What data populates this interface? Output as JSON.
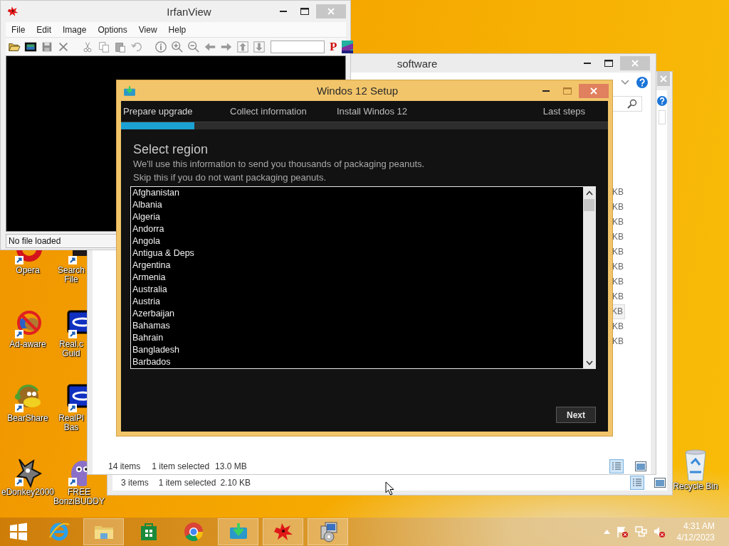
{
  "irfanview": {
    "title": "IrfanView",
    "menu": [
      "File",
      "Edit",
      "Image",
      "Options",
      "View",
      "Help"
    ],
    "toolbar_letter": "P",
    "status": "No file loaded"
  },
  "desktop_icons": [
    {
      "kind": "opera",
      "label": "Opera"
    },
    {
      "kind": "adaware",
      "label": "Ad-aware"
    },
    {
      "kind": "bear",
      "label": "BearShare"
    },
    {
      "kind": "donkey",
      "label": "eDonkey2000"
    },
    {
      "kind": "search",
      "label": "Search File"
    },
    {
      "kind": "real",
      "label": "Real.c Guid"
    },
    {
      "kind": "real",
      "label": "RealPl Bas"
    },
    {
      "kind": "bonzi",
      "label": "FREE BonziBUDDY"
    }
  ],
  "recycle_bin": {
    "label": "Recycle Bin"
  },
  "explorer_back": {
    "status_items": "3 items",
    "status_selection": "1 item selected",
    "status_size": "2.10 KB"
  },
  "explorer_front": {
    "title": "software",
    "size_cells": [
      {
        "text": "KB",
        "selected": false
      },
      {
        "text": "KB",
        "selected": false
      },
      {
        "text": "KB",
        "selected": false
      },
      {
        "text": "KB",
        "selected": false
      },
      {
        "text": "KB",
        "selected": false
      },
      {
        "text": "KB",
        "selected": false
      },
      {
        "text": "KB",
        "selected": false
      },
      {
        "text": "KB",
        "selected": false
      },
      {
        "text": "KB",
        "selected": true
      },
      {
        "text": "KB",
        "selected": false
      },
      {
        "text": "KB",
        "selected": false
      }
    ],
    "status_items": "14 items",
    "status_selection": "1 item selected",
    "status_size": "13.0 MB"
  },
  "setup": {
    "title": "Windos 12 Setup",
    "steps": [
      {
        "label": "Prepare upgrade",
        "selected": true
      },
      {
        "label": "Collect information",
        "selected": false
      },
      {
        "label": "Install Windos 12",
        "selected": false
      },
      {
        "label": "Last steps",
        "selected": false
      }
    ],
    "progress": {
      "level": 0.15
    },
    "heading": "Select region",
    "lines": [
      "We'll use this information to send you thousands of packaging peanuts.",
      "Skip this if you do not want packaging peanuts."
    ],
    "regions": [
      {
        "name": "Afghanistan",
        "selected": false
      },
      {
        "name": "Albania",
        "selected": false
      },
      {
        "name": "Algeria",
        "selected": false
      },
      {
        "name": "Andorra",
        "selected": false
      },
      {
        "name": "Angola",
        "selected": false
      },
      {
        "name": "Antigua & Deps",
        "selected": false
      },
      {
        "name": "Argentina",
        "selected": false
      },
      {
        "name": "Armenia",
        "selected": false
      },
      {
        "name": "Australia",
        "selected": false
      },
      {
        "name": "Austria",
        "selected": false
      },
      {
        "name": "Azerbaijan",
        "selected": false
      },
      {
        "name": "Bahamas",
        "selected": false
      },
      {
        "name": "Bahrain",
        "selected": false
      },
      {
        "name": "Bangladesh",
        "selected": false
      },
      {
        "name": "Barbados",
        "selected": false
      }
    ],
    "next_button": "Next"
  },
  "taskbar": {
    "apps": [
      {
        "kind": "start",
        "active": false
      },
      {
        "kind": "ie",
        "active": false
      },
      {
        "kind": "folder",
        "active": true
      },
      {
        "kind": "store",
        "active": false
      },
      {
        "kind": "chrome",
        "active": false
      },
      {
        "kind": "download",
        "active": true
      },
      {
        "kind": "irfan",
        "active": true
      },
      {
        "kind": "installer",
        "active": true
      }
    ],
    "time": "4:31 AM",
    "date": "4/12/2023"
  }
}
